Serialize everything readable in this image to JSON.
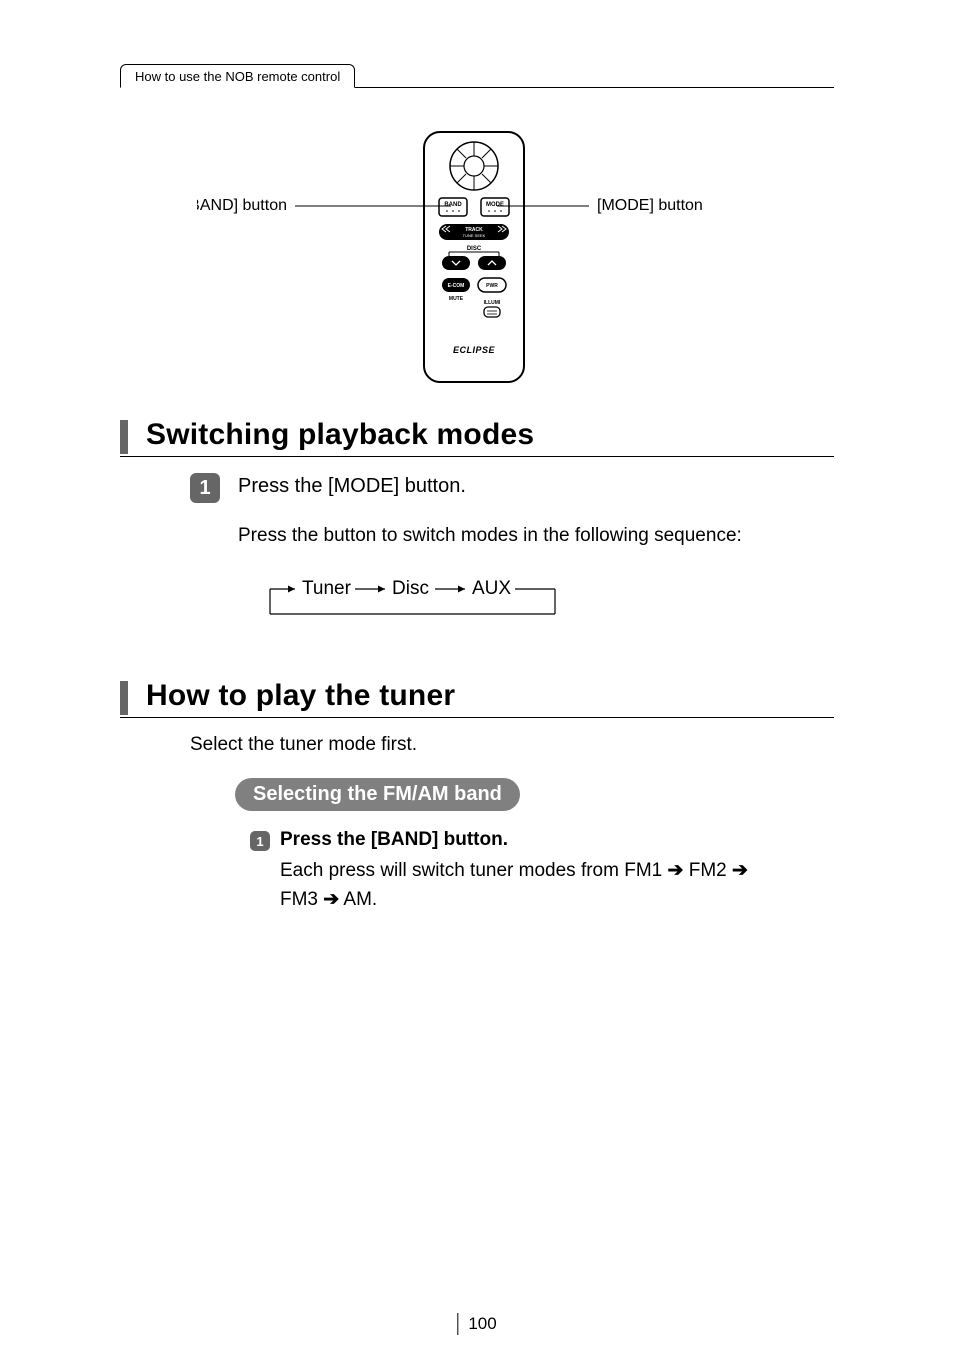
{
  "header": {
    "tab": "How to use the NOB remote control"
  },
  "diagram": {
    "left_label": "[BAND] button",
    "right_label": "[MODE] button",
    "brand": "ECLIPSE",
    "btn_band": "BAND",
    "btn_mode": "MODE",
    "track_label": "TRACK",
    "tune_label": "TUNE SEEK",
    "disc_label": "DISC",
    "ecom": "E-COM",
    "pwr": "PWR",
    "mute": "MUTE",
    "illumi": "ILLUMI"
  },
  "section1": {
    "title": "Switching playback modes",
    "step_num": "1",
    "step_text": "Press the [MODE] button.",
    "note": "Press the button to switch modes in the following sequence:",
    "flow": {
      "a": "Tuner",
      "b": "Disc",
      "c": "AUX"
    }
  },
  "section2": {
    "title": "How to play the tuner",
    "intro": "Select the tuner mode first.",
    "pill": "Selecting the FM/AM band",
    "sub_num": "1",
    "sub_title": "Press the [BAND] button.",
    "sub_body_pre": "Each press will switch tuner modes from FM1 ",
    "sub_body_fm2": " FM2 ",
    "sub_body_fm3": "FM3 ",
    "sub_body_am": " AM.",
    "arrow": "➔"
  },
  "page_number": "100"
}
